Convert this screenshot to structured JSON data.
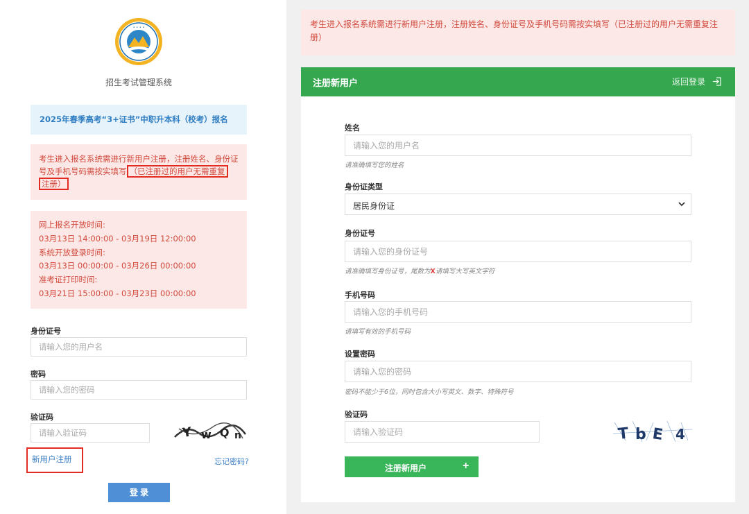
{
  "left": {
    "system_title": "招生考试管理系统",
    "exam_title": "2025年春季高考“3+证书”中职升本科（校考）报名",
    "notice_main": "考生进入报名系统需进行新用户注册，注册姓名、身份证号及手机号码需按实填写",
    "notice_part1": "（已注册过的用户无需重复",
    "notice_part2": "注册）",
    "times": [
      {
        "label": "网上报名开放时间:",
        "value": "03月13日 14:00:00 - 03月19日 12:00:00"
      },
      {
        "label": "系统开放登录时间:",
        "value": "03月13日 00:00:00 - 03月26日 00:00:00"
      },
      {
        "label": "准考证打印时间:",
        "value": "03月21日 15:00:00 - 03月23日 00:00:00"
      }
    ],
    "id_label": "身份证号",
    "id_placeholder": "请输入您的用户名",
    "password_label": "密码",
    "password_placeholder": "请输入您的密码",
    "captcha_label": "验证码",
    "captcha_placeholder": "请输入验证码",
    "register_link": "新用户注册",
    "forgot_link": "忘记密码?",
    "login_button": "登 录"
  },
  "right": {
    "notice": "考生进入报名系统需进行新用户注册，注册姓名、身份证号及手机号码需按实填写（已注册过的用户无需重复注册）",
    "card_title": "注册新用户",
    "back_login": "返回登录",
    "name_label": "姓名",
    "name_placeholder": "请输入您的用户名",
    "name_hint": "请准确填写您的姓名",
    "id_type_label": "身份证类型",
    "id_type_value": "居民身份证",
    "id_number_label": "身份证号",
    "id_number_placeholder": "请输入您的身份证号",
    "id_hint_pre": "请准确填写身份证号，尾数为",
    "id_hint_x": "X",
    "id_hint_post": "请填写大写英文字符",
    "phone_label": "手机号码",
    "phone_placeholder": "请输入您的手机号码",
    "phone_hint": "请填写有效的手机号码",
    "password_label": "设置密码",
    "password_placeholder": "请输入您的密码",
    "password_hint": "密码不能少于6位，同时包含大小写英文、数字、特殊符号",
    "captcha_label": "验证码",
    "captcha_placeholder": "请输入验证码",
    "register_button": "注册新用户"
  },
  "colors": {
    "green": "#35a84f",
    "blue_link": "#3a80c6",
    "red_text": "#d2493d",
    "highlight_border": "#e32b22"
  },
  "icons": [
    "school-logo",
    "exit-icon",
    "chevron-down-icon",
    "plus-icon"
  ]
}
